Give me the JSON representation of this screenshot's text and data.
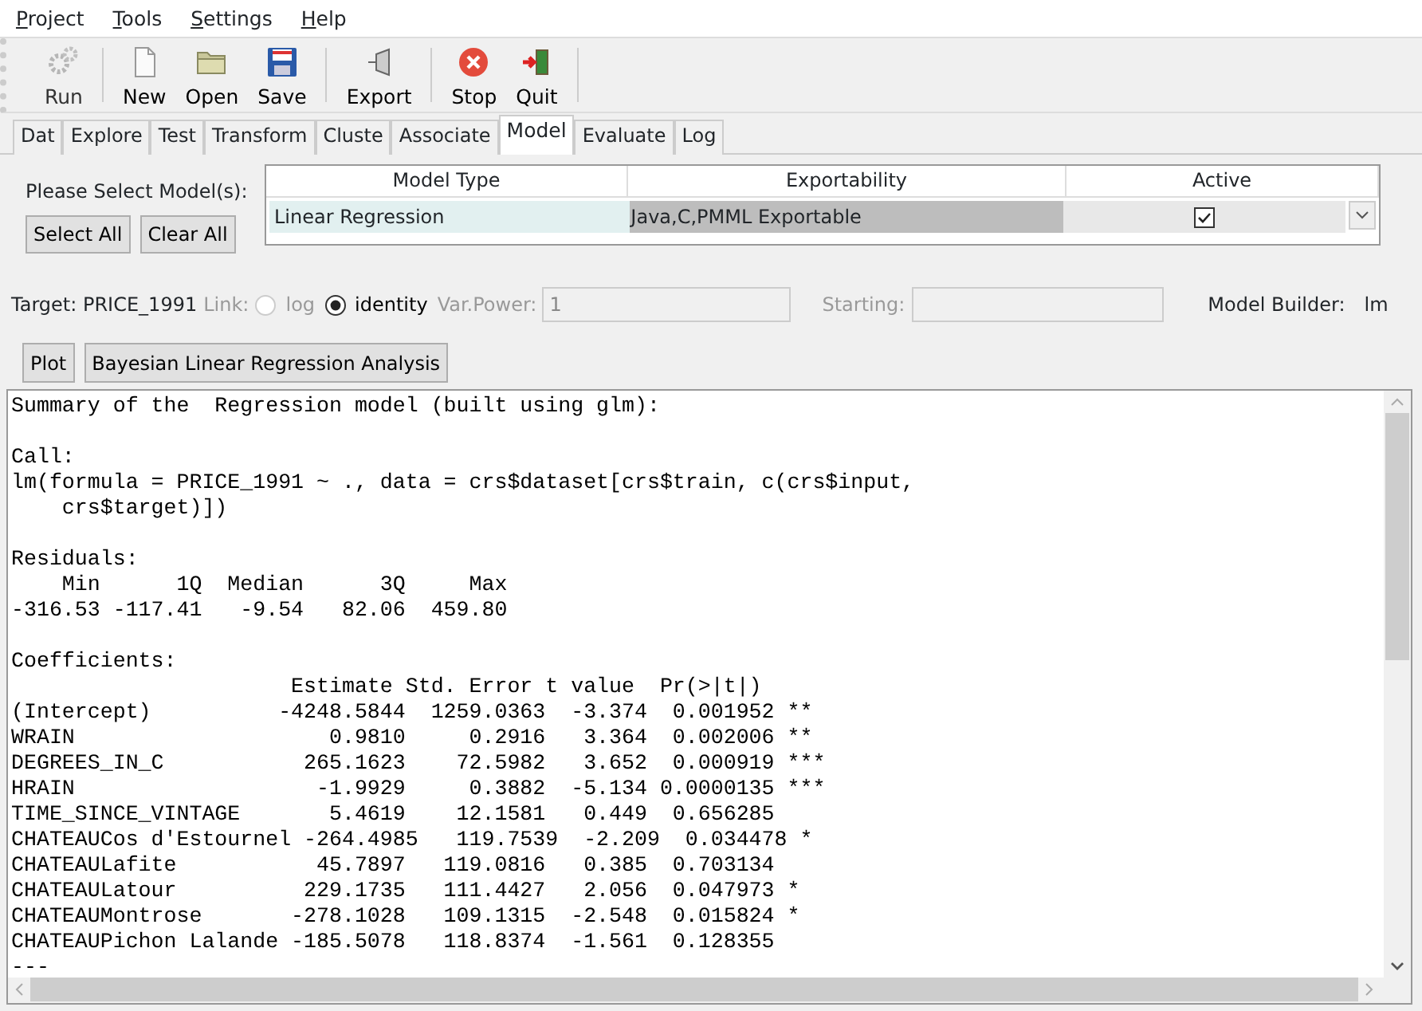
{
  "menu": [
    {
      "label": "Project"
    },
    {
      "label": "Tools"
    },
    {
      "label": "Settings"
    },
    {
      "label": "Help"
    }
  ],
  "toolbar": [
    {
      "label": "Run",
      "kind": "gear",
      "disabled": true
    },
    {
      "label": "New",
      "kind": "page",
      "disabled": false
    },
    {
      "label": "Open",
      "kind": "folder",
      "disabled": false
    },
    {
      "label": "Save",
      "kind": "disk",
      "disabled": false
    },
    {
      "label": "Export",
      "kind": "plug",
      "disabled": false
    },
    {
      "label": "Stop",
      "kind": "stop",
      "disabled": false
    },
    {
      "label": "Quit",
      "kind": "exit",
      "disabled": false
    }
  ],
  "tabs": [
    {
      "label": "Dat",
      "selected": false
    },
    {
      "label": "Explore",
      "selected": false
    },
    {
      "label": "Test",
      "selected": false
    },
    {
      "label": "Transform",
      "selected": false
    },
    {
      "label": "Cluste",
      "selected": false
    },
    {
      "label": "Associate",
      "selected": false
    },
    {
      "label": "Model",
      "selected": true
    },
    {
      "label": "Evaluate",
      "selected": false
    },
    {
      "label": "Log",
      "selected": false
    }
  ],
  "model_select": {
    "prompt": "Please Select Model(s):",
    "buttons": [
      "Select All",
      "Clear All"
    ],
    "columns": [
      "Model Type",
      "Exportability",
      "Active"
    ],
    "rows": [
      {
        "model_type": "Linear Regression",
        "exportability": "Java,C,PMML Exportable",
        "active": true
      }
    ]
  },
  "target": {
    "label": "Target: PRICE_1991",
    "link_label": "Link:",
    "links": [
      {
        "label": "log",
        "selected": false,
        "disabled": true
      },
      {
        "label": "identity",
        "selected": true,
        "disabled": false
      }
    ],
    "var_power": {
      "label": "Var.Power:",
      "value": "1"
    },
    "starting": {
      "label": "Starting:"
    },
    "builder_label": "Model Builder:",
    "builder": "lm"
  },
  "actions": [
    "Plot",
    "Bayesian Linear Regression Analysis"
  ],
  "output": [
    [
      "Summary of the  Regression model (built using glm):"
    ],
    [
      "Call:",
      "lm(formula = PRICE_1991 ~ ., data = crs$dataset[crs$train, c(crs$input,",
      "    crs$target)])"
    ],
    [
      "Residuals:",
      "    Min      1Q  Median      3Q     Max ",
      "-316.53 -117.41   -9.54   82.06  459.80 "
    ],
    [
      "Coefficients:",
      "                      Estimate Std. Error t value  Pr(>|t|)    ",
      "(Intercept)          -4248.5844  1259.0363  -3.374  0.001952 ** ",
      "WRAIN                    0.9810     0.2916   3.364  0.002006 ** ",
      "DEGREES_IN_C           265.1623    72.5982   3.652  0.000919 ***",
      "HRAIN                   -1.9929     0.3882  -5.134 0.0000135 ***",
      "TIME_SINCE_VINTAGE       5.4619    12.1581   0.449  0.656285    ",
      "CHATEAUCos d'Estournel -264.4985   119.7539  -2.209  0.034478 *  ",
      "CHATEAULafite           45.7897   119.0816   0.385  0.703134    ",
      "CHATEAULatour          229.1735   111.4427   2.056  0.047973 *  ",
      "CHATEAUMontrose       -278.1028   109.1315  -2.548  0.015824 *  ",
      "CHATEAUPichon Lalande -185.5078   118.8374  -1.561  0.128355    ",
      "---"
    ]
  ]
}
